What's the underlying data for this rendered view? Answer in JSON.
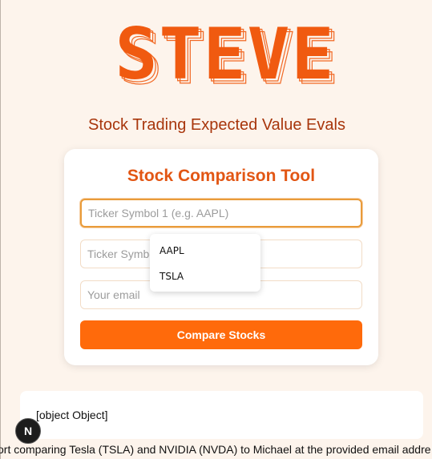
{
  "header": {
    "logo_text": "STEVE",
    "subtitle": "Stock Trading Expected Value Evals"
  },
  "form": {
    "title": "Stock Comparison Tool",
    "ticker1_placeholder": "Ticker Symbol 1 (e.g. AAPL)",
    "ticker2_placeholder": "Ticker Symbol 2 (e.g. TSLA)",
    "email_placeholder": "Your email",
    "submit_label": "Compare Stocks"
  },
  "autocomplete": {
    "options": [
      "AAPL",
      "TSLA"
    ]
  },
  "result": {
    "text": "[object Object]"
  },
  "ticker_message": "ort comparing Tesla (TSLA) and NVIDIA (NVDA) to Michael at the provided email addre",
  "badge": {
    "letter": "N"
  },
  "colors": {
    "accent": "#ff6a0b",
    "logo": "#f05a10",
    "subtitle": "#a8360c",
    "background": "#fdf4ec"
  }
}
